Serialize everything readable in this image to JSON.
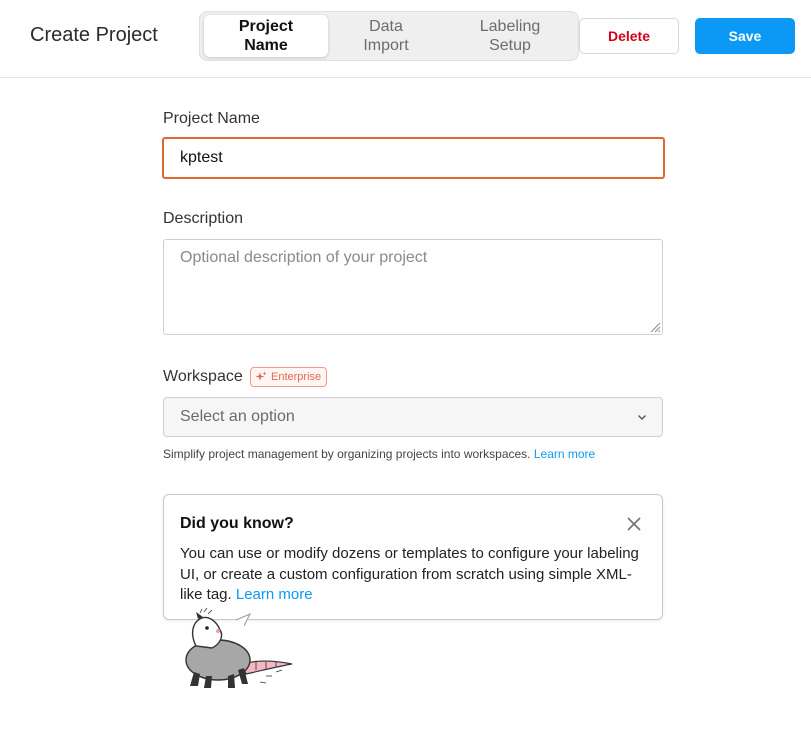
{
  "header": {
    "title": "Create Project",
    "tabs": [
      {
        "label": "Project\nName",
        "active": true
      },
      {
        "label": "Data\nImport",
        "active": false
      },
      {
        "label": "Labeling\nSetup",
        "active": false
      }
    ],
    "delete_label": "Delete",
    "save_label": "Save"
  },
  "form": {
    "name_label": "Project Name",
    "name_value": "kptest",
    "description_label": "Description",
    "description_placeholder": "Optional description of your project",
    "workspace_label": "Workspace",
    "workspace_badge": "Enterprise",
    "workspace_placeholder": "Select an option",
    "workspace_help": "Simplify project management by organizing projects into workspaces.",
    "workspace_help_link": "Learn more"
  },
  "tip": {
    "title": "Did you know?",
    "body": "You can use or modify dozens or templates to configure your labeling UI, or create a custom configuration from scratch using simple XML-like tag.",
    "link": "Learn more"
  },
  "colors": {
    "accent": "#0b99f5",
    "danger": "#d0021b",
    "focus_border": "#e0682f",
    "badge": "#e06a54"
  },
  "icons": [
    "sparkle-icon",
    "chevron-down-icon",
    "close-icon",
    "opossum-mascot"
  ]
}
